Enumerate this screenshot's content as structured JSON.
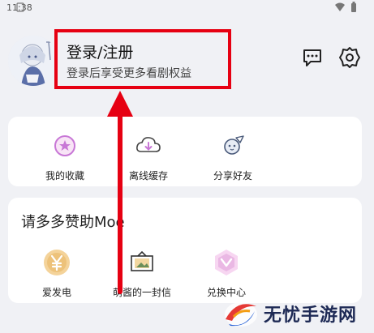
{
  "status_bar": {
    "time": "11:38"
  },
  "header": {
    "login_title": "登录/注册",
    "login_subtitle": "登录后享受更多看剧权益",
    "message_icon": "message-icon",
    "settings_icon": "gear-icon"
  },
  "quick_actions": [
    {
      "label": "我的收藏",
      "icon": "star-badge-icon"
    },
    {
      "label": "离线缓存",
      "icon": "cloud-download-icon"
    },
    {
      "label": "分享好友",
      "icon": "share-planet-icon"
    }
  ],
  "support": {
    "title": "请多多赞助Moe",
    "items": [
      {
        "label": "爱发电",
        "icon": "yen-coin-icon"
      },
      {
        "label": "萌酱的一封信",
        "icon": "letter-icon"
      },
      {
        "label": "兑换中心",
        "icon": "exchange-badge-icon"
      }
    ]
  },
  "watermark": {
    "text": "无忧手游网"
  },
  "colors": {
    "highlight": "#e60012",
    "accent_pink": "#c877d6",
    "background": "#f0f1f5"
  }
}
